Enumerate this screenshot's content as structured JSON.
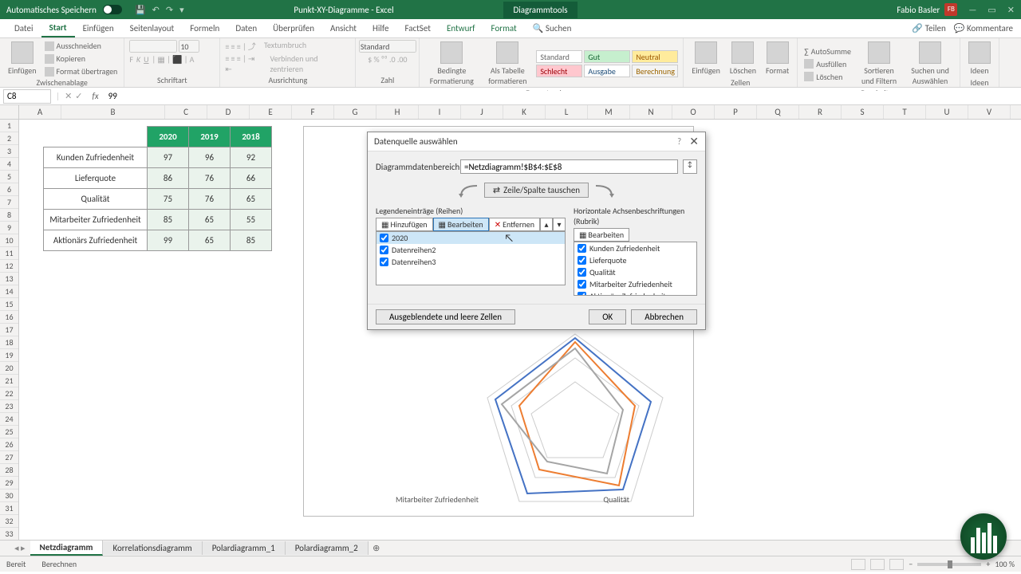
{
  "titlebar": {
    "autosave_label": "Automatisches Speichern",
    "doc_title": "Punkt-XY-Diagramme - Excel",
    "tools_label": "Diagrammtools",
    "user_name": "Fabio Basler",
    "user_initials": "FB"
  },
  "tabs": {
    "items": [
      "Datei",
      "Start",
      "Einfügen",
      "Seitenlayout",
      "Formeln",
      "Daten",
      "Überprüfen",
      "Ansicht",
      "Hilfe",
      "FactSet",
      "Entwurf",
      "Format"
    ],
    "search": "Suchen",
    "share": "Teilen",
    "comments": "Kommentare"
  },
  "ribbon": {
    "groups": {
      "clipboard": {
        "label": "Zwischenablage",
        "paste": "Einfügen",
        "cut": "Ausschneiden",
        "copy": "Kopieren",
        "format_painter": "Format übertragen"
      },
      "font": {
        "label": "Schriftart",
        "font_size": "10"
      },
      "alignment": {
        "label": "Ausrichtung",
        "wrap": "Textumbruch",
        "merge": "Verbinden und zentrieren"
      },
      "number": {
        "label": "Zahl",
        "format": "Standard"
      },
      "cond": {
        "label": "Formatvorlagen",
        "cond_fmt": "Bedingte Formatierung",
        "table_fmt": "Als Tabelle formatieren"
      },
      "styles_grid": [
        [
          "Standard",
          "Gut",
          "Neutral"
        ],
        [
          "Schlecht",
          "Ausgabe",
          "Berechnung"
        ]
      ],
      "cells": {
        "label": "Zellen",
        "insert": "Einfügen",
        "delete": "Löschen",
        "format": "Format"
      },
      "editing": {
        "label": "Bearbeiten",
        "autosum": "AutoSumme",
        "fill": "Ausfüllen",
        "clear": "Löschen",
        "sort": "Sortieren und Filtern",
        "find": "Suchen und Auswählen"
      },
      "ideas": {
        "label": "Ideen",
        "ideen": "Ideen"
      }
    }
  },
  "namebox": {
    "ref": "C8",
    "formula": "99"
  },
  "columns": [
    "A",
    "B",
    "C",
    "D",
    "E",
    "F",
    "G",
    "H",
    "I",
    "J",
    "K",
    "L",
    "M",
    "N",
    "O",
    "P",
    "Q",
    "R",
    "S",
    "T",
    "U",
    "V"
  ],
  "table": {
    "years": [
      "2020",
      "2019",
      "2018"
    ],
    "rows": [
      {
        "label": "Kunden Zufriedenheit",
        "vals": [
          "97",
          "96",
          "92"
        ]
      },
      {
        "label": "Lieferquote",
        "vals": [
          "86",
          "76",
          "66"
        ]
      },
      {
        "label": "Qualität",
        "vals": [
          "75",
          "76",
          "65"
        ]
      },
      {
        "label": "Mitarbeiter Zufriedenheit",
        "vals": [
          "85",
          "65",
          "55"
        ]
      },
      {
        "label": "Aktionärs Zufriedenheit",
        "vals": [
          "99",
          "65",
          "85"
        ]
      }
    ]
  },
  "chart_labels": {
    "mit": "Mitarbeiter Zufriedenheit",
    "qual": "Qualität"
  },
  "dialog": {
    "title": "Datenquelle auswählen",
    "range_label": "Diagrammdatenbereich:",
    "range_value": "=Netzdiagramm!$B$4:$E$8",
    "switch": "Zeile/Spalte tauschen",
    "legend_label": "Legendeneinträge (Reihen)",
    "axis_label": "Horizontale Achsenbeschriftungen (Rubrik)",
    "btn_add": "Hinzufügen",
    "btn_edit": "Bearbeiten",
    "btn_remove": "Entfernen",
    "btn_edit2": "Bearbeiten",
    "series": [
      "2020",
      "Datenreihen2",
      "Datenreihen3"
    ],
    "categories": [
      "Kunden Zufriedenheit",
      "Lieferquote",
      "Qualität",
      "Mitarbeiter Zufriedenheit",
      "Aktionärs Zufriedenheit"
    ],
    "hidden_btn": "Ausgeblendete und leere Zellen",
    "ok": "OK",
    "cancel": "Abbrechen"
  },
  "sheet_tabs": [
    "Netzdiagramm",
    "Korrelationsdiagramm",
    "Polardiagramm_1",
    "Polardiagramm_2"
  ],
  "statusbar": {
    "ready": "Bereit",
    "calc": "Berechnen",
    "zoom": "100 %"
  },
  "chart_data": {
    "type": "radar",
    "categories": [
      "Kunden Zufriedenheit",
      "Lieferquote",
      "Qualität",
      "Mitarbeiter Zufriedenheit",
      "Aktionärs Zufriedenheit"
    ],
    "series": [
      {
        "name": "2020",
        "values": [
          97,
          86,
          75,
          85,
          99
        ]
      },
      {
        "name": "2019",
        "values": [
          96,
          76,
          76,
          65,
          65
        ]
      },
      {
        "name": "2018",
        "values": [
          92,
          66,
          65,
          55,
          85
        ]
      }
    ]
  }
}
